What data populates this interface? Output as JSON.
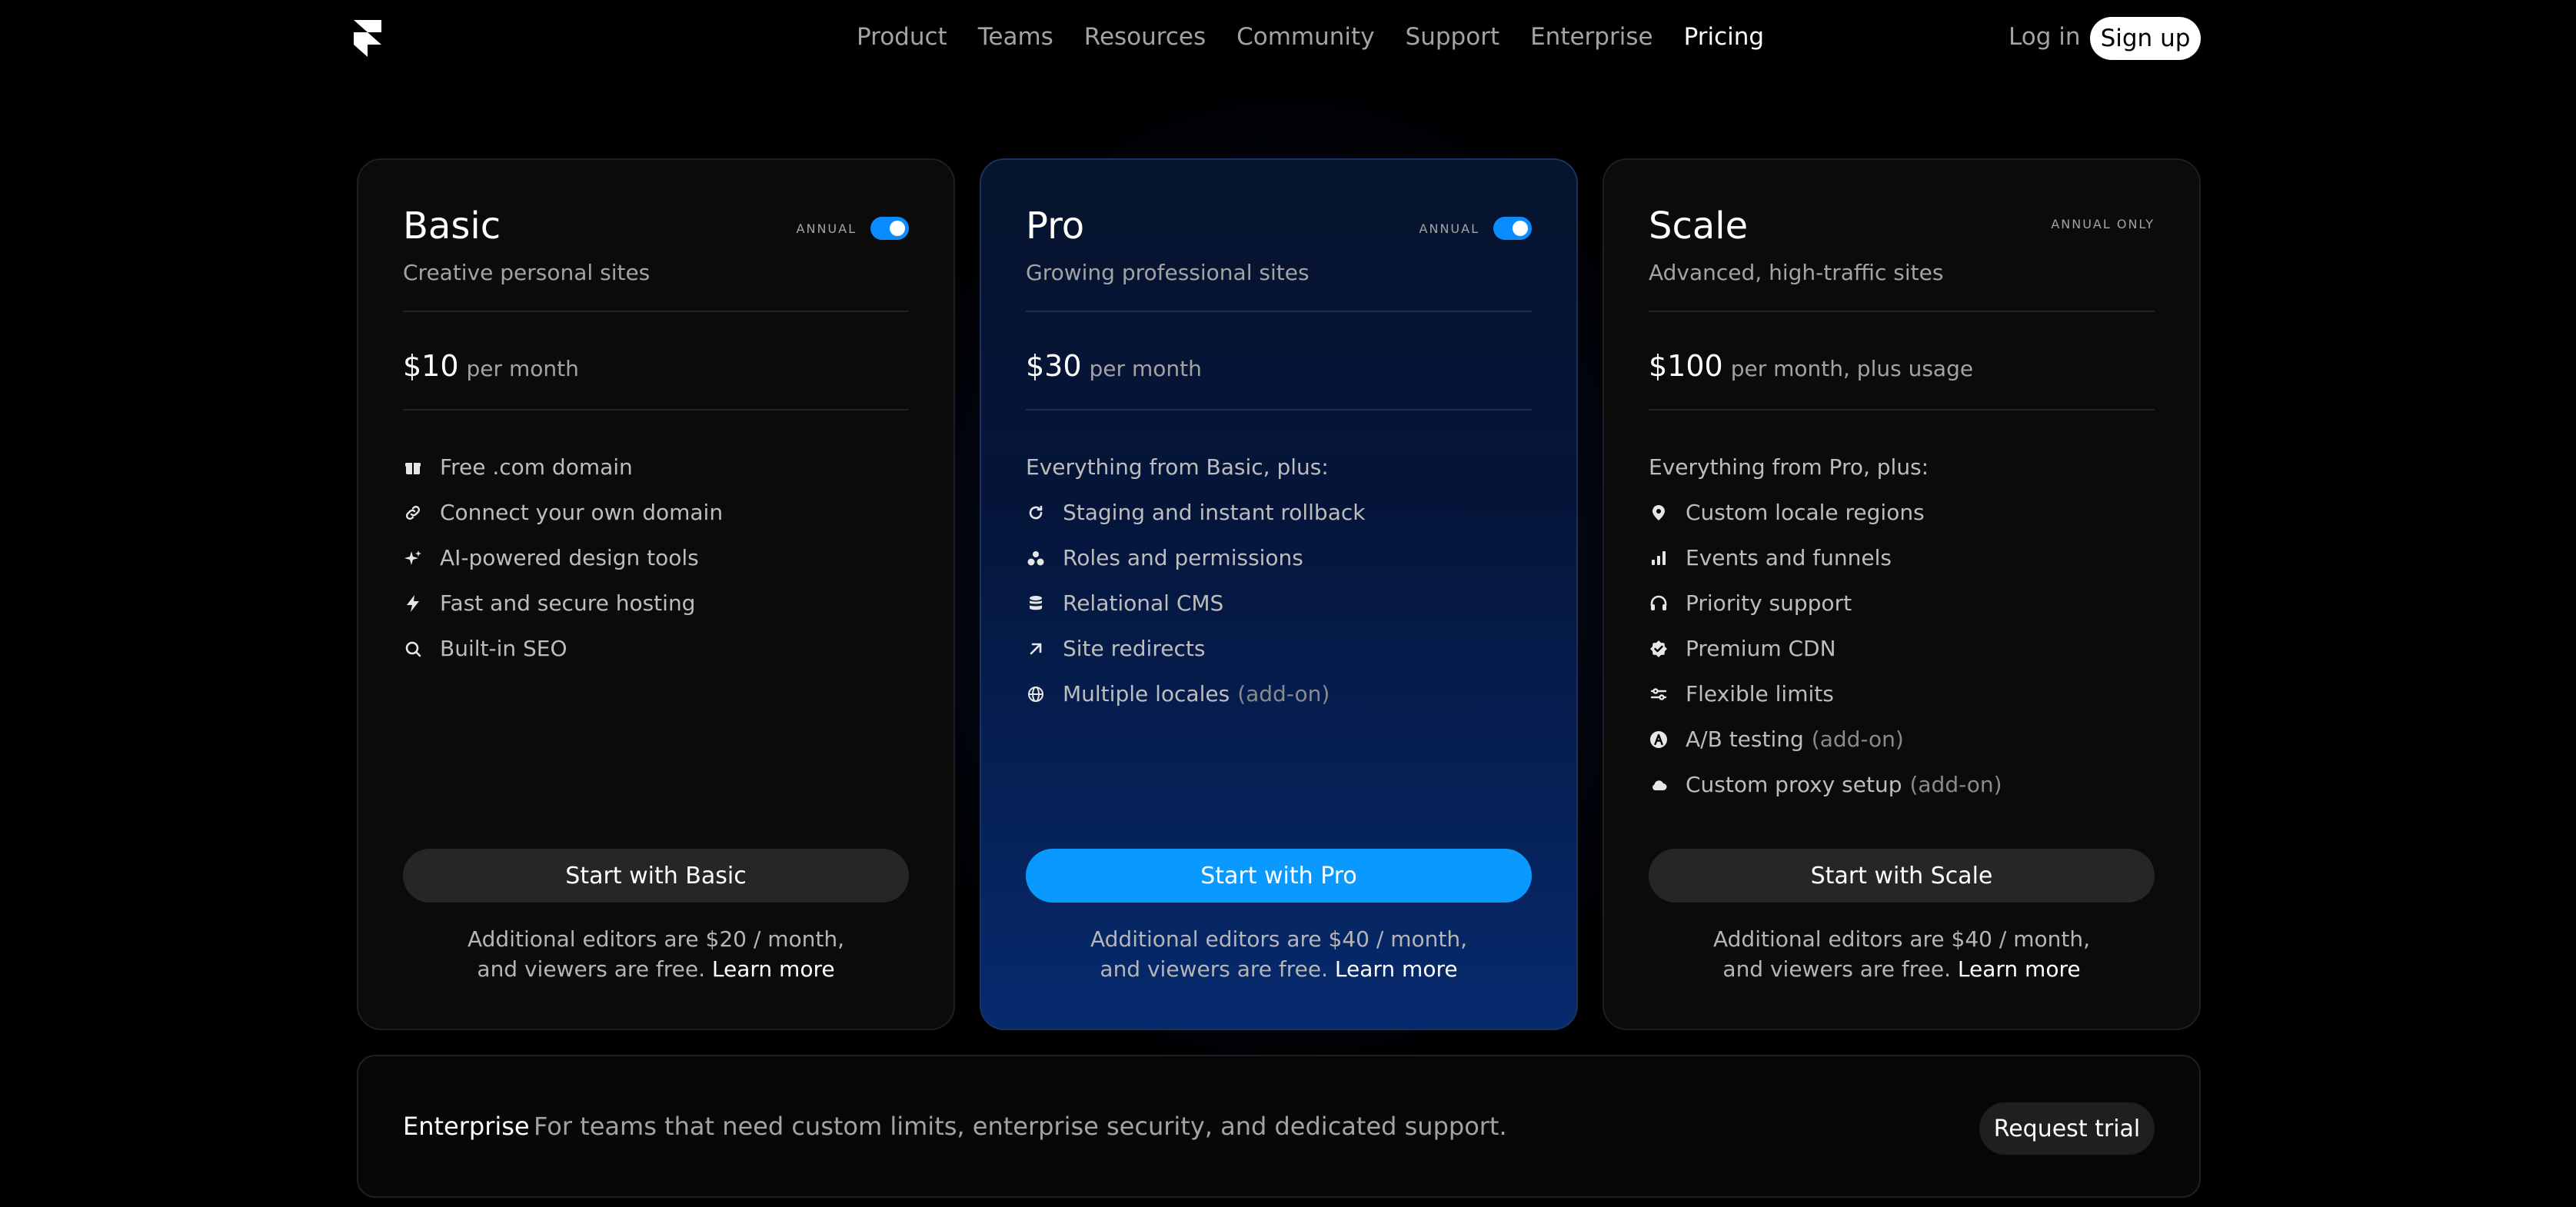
{
  "nav": {
    "links": [
      "Product",
      "Teams",
      "Resources",
      "Community",
      "Support",
      "Enterprise",
      "Pricing"
    ],
    "active": "Pricing",
    "login": "Log in",
    "signup": "Sign up"
  },
  "plans": [
    {
      "title": "Basic",
      "subtitle": "Creative personal sites",
      "billing_label": "ANNUAL",
      "annual_toggle_on": true,
      "price": "$10",
      "price_period": "per month",
      "intro": "",
      "features": [
        {
          "icon": "gift-icon",
          "text": "Free .com domain",
          "addon": ""
        },
        {
          "icon": "link-icon",
          "text": "Connect your own domain",
          "addon": ""
        },
        {
          "icon": "sparkle-icon",
          "text": "AI-powered design tools",
          "addon": ""
        },
        {
          "icon": "lightning-icon",
          "text": "Fast and secure hosting",
          "addon": ""
        },
        {
          "icon": "search-icon",
          "text": "Built-in SEO",
          "addon": ""
        }
      ],
      "cta": "Start with Basic",
      "note_line1": "Additional editors are $20 / month,",
      "note_line2": "and viewers are free.",
      "learn_more": "Learn more"
    },
    {
      "title": "Pro",
      "subtitle": "Growing professional sites",
      "billing_label": "ANNUAL",
      "annual_toggle_on": true,
      "price": "$30",
      "price_period": "per month",
      "intro": "Everything from Basic, plus:",
      "features": [
        {
          "icon": "refresh-icon",
          "text": "Staging and instant rollback",
          "addon": ""
        },
        {
          "icon": "users-icon",
          "text": "Roles and permissions",
          "addon": ""
        },
        {
          "icon": "database-icon",
          "text": "Relational CMS",
          "addon": ""
        },
        {
          "icon": "arrow-up-right-icon",
          "text": "Site redirects",
          "addon": ""
        },
        {
          "icon": "globe-icon",
          "text": "Multiple locales",
          "addon": "(add-on)"
        }
      ],
      "cta": "Start with Pro",
      "note_line1": "Additional editors are $40 / month,",
      "note_line2": "and viewers are free.",
      "learn_more": "Learn more"
    },
    {
      "title": "Scale",
      "subtitle": "Advanced, high-traffic sites",
      "billing_label": "ANNUAL ONLY",
      "annual_toggle_on": false,
      "price": "$100",
      "price_period": "per month, plus usage",
      "intro": "Everything from Pro, plus:",
      "features": [
        {
          "icon": "map-pin-icon",
          "text": "Custom locale regions",
          "addon": ""
        },
        {
          "icon": "bar-chart-icon",
          "text": "Events and funnels",
          "addon": ""
        },
        {
          "icon": "headphones-icon",
          "text": "Priority support",
          "addon": ""
        },
        {
          "icon": "verified-badge-icon",
          "text": "Premium CDN",
          "addon": ""
        },
        {
          "icon": "sliders-icon",
          "text": "Flexible limits",
          "addon": ""
        },
        {
          "icon": "ab-test-icon",
          "text": "A/B testing",
          "addon": "(add-on)"
        },
        {
          "icon": "cloud-icon",
          "text": "Custom proxy setup",
          "addon": "(add-on)"
        }
      ],
      "cta": "Start with Scale",
      "note_line1": "Additional editors are $40 / month,",
      "note_line2": "and viewers are free.",
      "learn_more": "Learn more"
    }
  ],
  "enterprise": {
    "title": "Enterprise",
    "description": "For teams that need custom limits, enterprise security, and dedicated support.",
    "cta": "Request trial"
  },
  "colors": {
    "accent": "#0a99ff",
    "background": "#000000",
    "muted_text": "#a3a3a3"
  }
}
